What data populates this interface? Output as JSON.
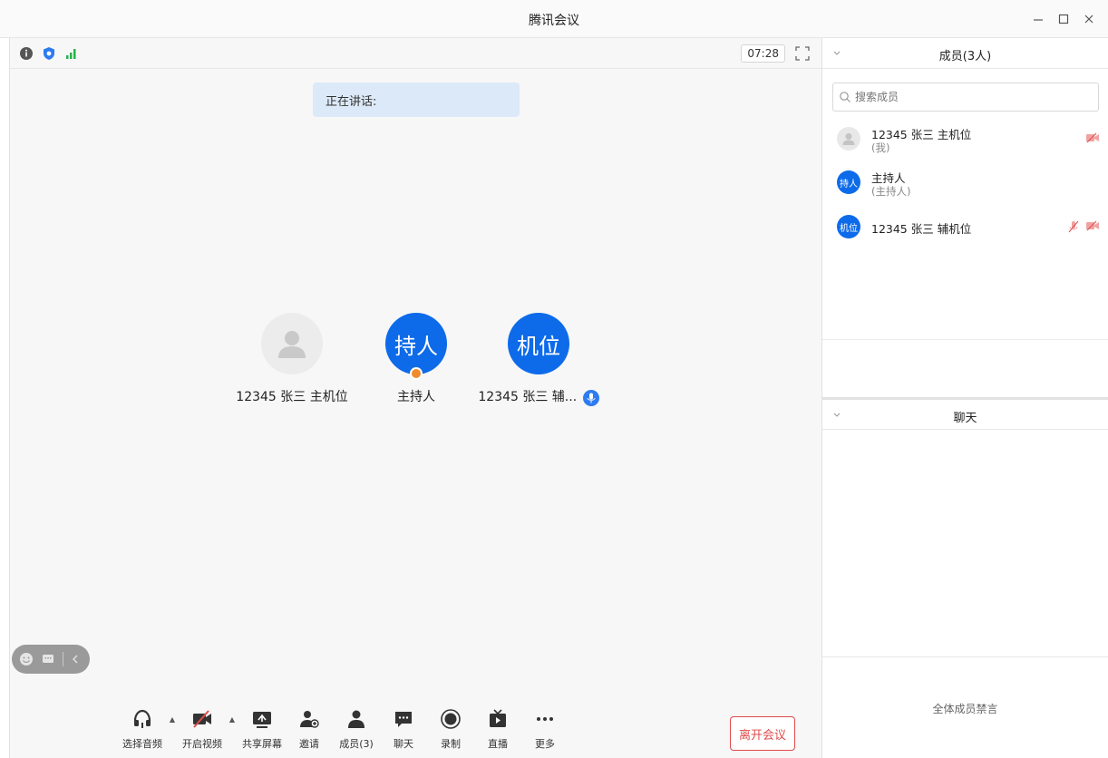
{
  "window": {
    "title": "腾讯会议"
  },
  "stage": {
    "timer": "07:28",
    "speaking_label": "正在讲话:",
    "participants": [
      {
        "name": "12345 张三 主机位",
        "avatar_text": ""
      },
      {
        "name": "主持人",
        "avatar_text": "持人"
      },
      {
        "name": "12345 张三 辅...",
        "avatar_text": "机位"
      }
    ]
  },
  "toolbar": {
    "items": [
      {
        "label": "选择音频",
        "icon": "headphones-icon"
      },
      {
        "label": "开启视频",
        "icon": "camera-off-icon"
      },
      {
        "label": "共享屏幕",
        "icon": "share-screen-icon"
      },
      {
        "label": "邀请",
        "icon": "invite-icon"
      },
      {
        "label": "成员(3)",
        "icon": "members-icon"
      },
      {
        "label": "聊天",
        "icon": "chat-icon"
      },
      {
        "label": "录制",
        "icon": "record-icon"
      },
      {
        "label": "直播",
        "icon": "live-icon"
      },
      {
        "label": "更多",
        "icon": "more-icon"
      }
    ],
    "leave_label": "离开会议"
  },
  "members": {
    "title": "成员(3人)",
    "search_placeholder": "搜索成员",
    "list": [
      {
        "name": "12345 张三 主机位",
        "sub": "(我)",
        "avatar_text": ""
      },
      {
        "name": "主持人",
        "sub": "(主持人)",
        "avatar_text": "持人"
      },
      {
        "name": "12345 张三 辅机位",
        "sub": "",
        "avatar_text": "机位"
      }
    ]
  },
  "chat": {
    "title": "聊天",
    "mute_all": "全体成员禁言"
  },
  "colors": {
    "accent": "#0d6bea",
    "danger": "#e04b4b",
    "host_badge": "#f08a2c",
    "speaking_bg": "#dce9f8"
  }
}
